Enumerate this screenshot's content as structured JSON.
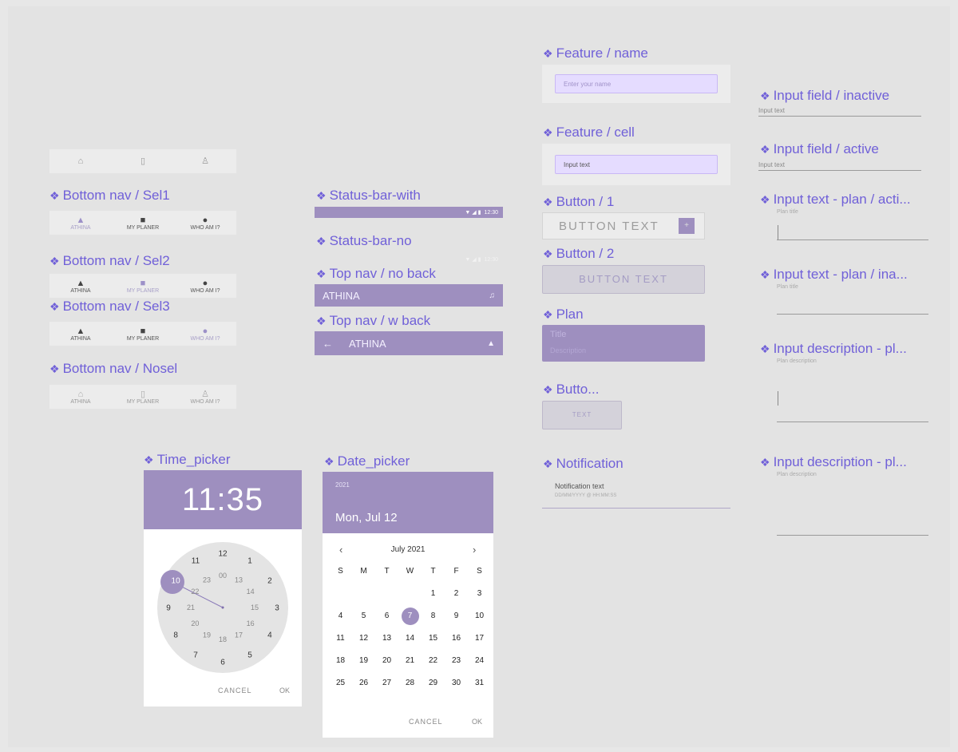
{
  "colors": {
    "accent": "#7060d8",
    "brand": "#9e8fbf",
    "field_bg": "#e5dcff"
  },
  "labels": {
    "bottom_nav_sel1": "Bottom nav / Sel1",
    "bottom_nav_sel2": "Bottom nav / Sel2",
    "bottom_nav_sel3": "Bottom nav / Sel3",
    "bottom_nav_nosel": "Bottom nav / Nosel",
    "status_bar_with": "Status-bar-with",
    "status_bar_no": "Status-bar-no",
    "top_nav_no_back": "Top nav / no back",
    "top_nav_w_back": "Top nav / w back",
    "feature_name": "Feature / name",
    "feature_cell": "Feature / cell",
    "button_1": "Button / 1",
    "button_2": "Button / 2",
    "plan": "Plan",
    "butto": "Butto...",
    "notification": "Notification",
    "input_inactive": "Input field / inactive",
    "input_active": "Input field / active",
    "input_plan_active": "Input text - plan / acti...",
    "input_plan_inactive": "Input text - plan / ina...",
    "input_desc_1": "Input description - pl...",
    "input_desc_2": "Input description - pl...",
    "time_picker": "Time_picker",
    "date_picker": "Date_picker"
  },
  "nav": {
    "athina": "ATHINA",
    "planer": "MY PLANER",
    "whoami": "WHO AM I?"
  },
  "status": {
    "time": "12:30",
    "icons": "▼ ◢ ▮"
  },
  "topnav": {
    "title": "ATHINA",
    "back_arrow": "←"
  },
  "feature": {
    "name_placeholder": "Enter your name",
    "cell_value": "Input text"
  },
  "buttons": {
    "button_text": "BUTTON TEXT",
    "plus": "+",
    "text": "TEXT"
  },
  "plan": {
    "title": "Title",
    "description": "Description"
  },
  "notification": {
    "text": "Notification text",
    "datetime": "DD/MM/YYYY @ HH:MM:SS"
  },
  "inputs": {
    "input_text": "Input text",
    "plan_title": "Plan title",
    "plan_description": "Plan description"
  },
  "time_picker": {
    "time": "11:35",
    "outer": [
      "12",
      "1",
      "2",
      "3",
      "4",
      "5",
      "6",
      "7",
      "8",
      "9",
      "10",
      "11"
    ],
    "inner": [
      "00",
      "13",
      "14",
      "15",
      "16",
      "17",
      "18",
      "19",
      "20",
      "21",
      "22",
      "23"
    ],
    "cancel": "CANCEL",
    "ok": "OK"
  },
  "date_picker": {
    "year": "2021",
    "date": "Mon, Jul 12",
    "month": "July 2021",
    "prev": "‹",
    "next": "›",
    "weekdays": [
      "S",
      "M",
      "T",
      "W",
      "T",
      "F",
      "S"
    ],
    "weeks": [
      [
        "",
        "",
        "",
        "",
        "1",
        "2",
        "3"
      ],
      [
        "4",
        "5",
        "6",
        "7",
        "8",
        "9",
        "10"
      ],
      [
        "11",
        "12",
        "13",
        "14",
        "15",
        "16",
        "17"
      ],
      [
        "18",
        "19",
        "20",
        "21",
        "22",
        "23",
        "24"
      ],
      [
        "25",
        "26",
        "27",
        "28",
        "29",
        "30",
        "31"
      ]
    ],
    "selected_day": "7",
    "cancel": "CANCEL",
    "ok": "OK"
  }
}
